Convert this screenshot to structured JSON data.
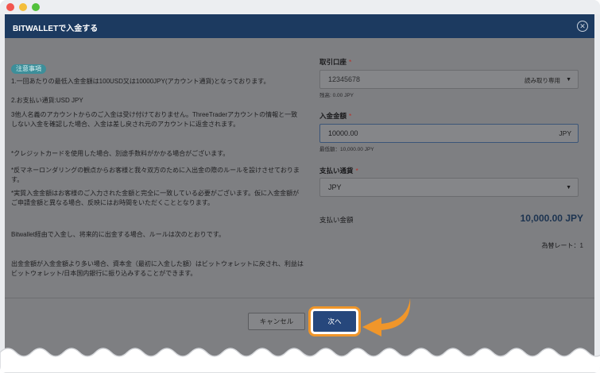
{
  "window": {
    "title": "BITWALLETで入金する"
  },
  "notice": {
    "badge": "注意事項",
    "lines": [
      "1.一回あたりの最低入金金額は100USD又は10000JPY(アカウント通貨)となっております。",
      "2.お支払い通貨:USD JPY",
      "3他人名義のアカウントからのご入金は受け付けておりません。ThreeTraderアカウントの情報と一致しない入金を確認した場合、入金は差し戻され元のアカウントに返金されます。",
      "*クレジットカードを使用した場合、別途手数料がかかる場合がございます。",
      "*反マネーロンダリングの観点からお客様と我々双方のために入出金の際のルールを設けさせております。",
      "*実質入金金額はお客様のご入力された金額と完全に一致している必要がございます。仮に入金金額がご申請金額と異なる場合、反映にはお時間をいただくこととなります。",
      "Bitwallet経由で入金し、将来的に出金する場合、ルールは次のとおりです。",
      "出金金額が入金金額より多い場合、資本金（最初に入金した額）はビットウォレットに戻され、利益はビットウォレット/日本国内銀行に振り込みすることができます。"
    ]
  },
  "form": {
    "account": {
      "label": "取引口座",
      "required": "*",
      "value": "12345678",
      "tag": "読み取り専用",
      "hint": "残高: 0.00 JPY"
    },
    "amount": {
      "label": "入金金額",
      "required": "*",
      "value": "10000.00",
      "unit": "JPY",
      "hint": "最低額：10,000.00 JPY"
    },
    "currency": {
      "label": "支払い通貨",
      "required": "*",
      "value": "JPY"
    },
    "payment_amount": {
      "label": "支払い金額",
      "value": "10,000.00 JPY"
    },
    "exchange_rate": "為替レート：1"
  },
  "buttons": {
    "cancel": "キャンセル",
    "next": "次へ"
  },
  "colors": {
    "header": "#1c3a60",
    "primary_button": "#26477c",
    "highlight": "#f0962a",
    "badge": "#3d8f9a"
  },
  "icons": {
    "close": "close-icon",
    "dropdown": "chevron-down-icon",
    "pointer": "arrow-pointer-icon"
  }
}
